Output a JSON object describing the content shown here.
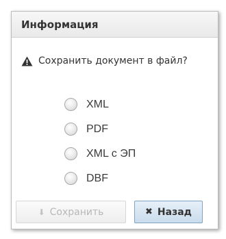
{
  "dialog": {
    "title": "Информация",
    "question": "Сохранить документ в файл?",
    "question_icon": "warning-icon"
  },
  "options": [
    {
      "label": "XML",
      "selected": false
    },
    {
      "label": "PDF",
      "selected": false
    },
    {
      "label": "XML с ЭП",
      "selected": false
    },
    {
      "label": "DBF",
      "selected": false
    }
  ],
  "buttons": {
    "save": {
      "label": "Сохранить",
      "icon": "download-arrow-icon",
      "enabled": false
    },
    "back": {
      "label": "Назад",
      "icon": "close-x-icon",
      "enabled": true
    }
  },
  "colors": {
    "back_button_accent": "#c9dcec",
    "disabled_text": "#b7b7b7"
  }
}
